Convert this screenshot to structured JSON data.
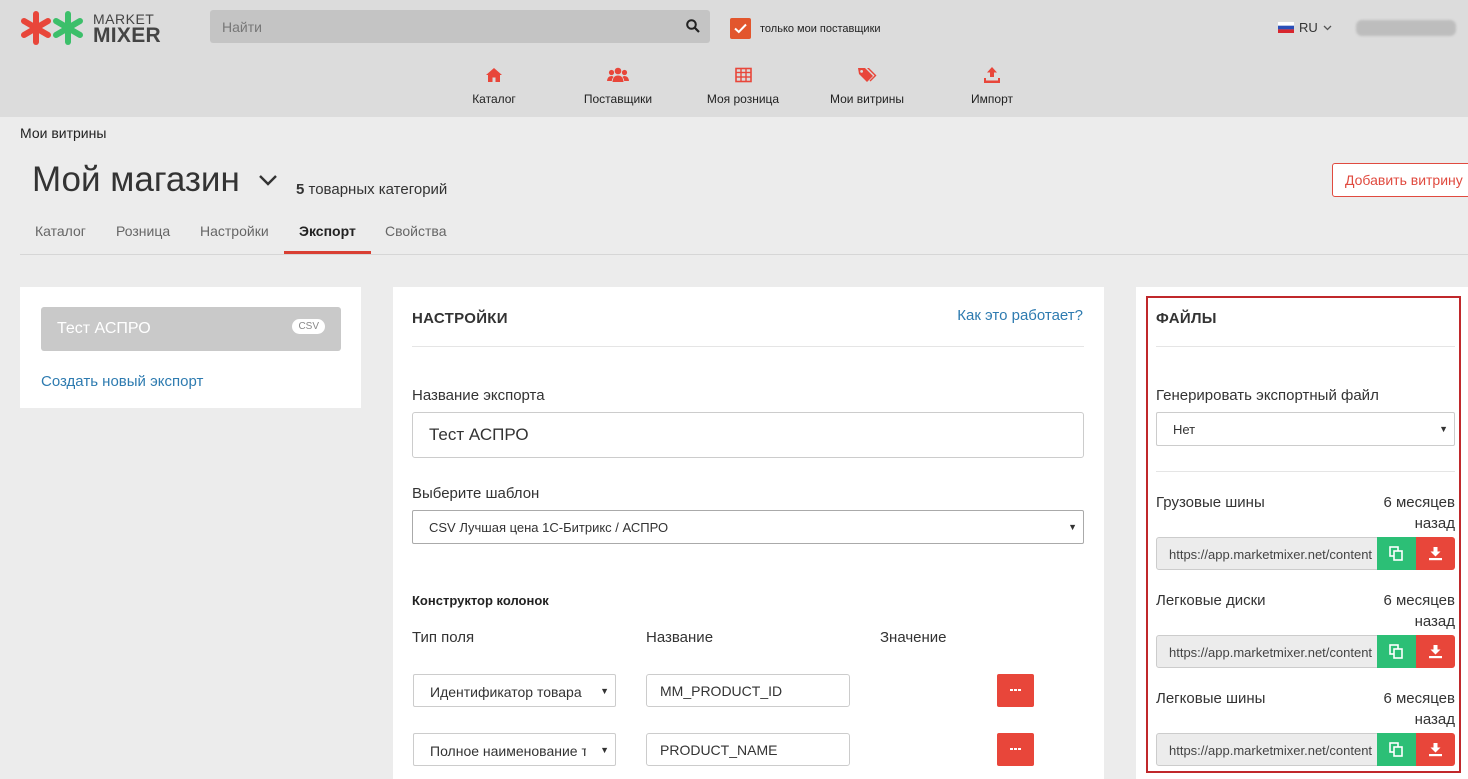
{
  "header": {
    "logo_line1": "MARKET",
    "logo_line2": "MIXER",
    "search_placeholder": "Найти",
    "only_my_suppliers": "только мои поставщики",
    "only_my_suppliers_checked": true,
    "language": "RU",
    "brand_color": "#e8463a",
    "accent_green": "#2cbf76"
  },
  "nav": [
    {
      "label": "Каталог",
      "icon": "home-icon"
    },
    {
      "label": "Поставщики",
      "icon": "users-icon"
    },
    {
      "label": "Моя розница",
      "icon": "table-icon"
    },
    {
      "label": "Мои витрины",
      "icon": "tags-icon"
    },
    {
      "label": "Импорт",
      "icon": "upload-icon"
    }
  ],
  "page": {
    "breadcrumb": "Мои витрины",
    "shop_title": "Мой магазин",
    "category_count": "5",
    "category_count_suffix": "товарных категорий",
    "add_button": "Добавить витрину",
    "tabs": [
      "Каталог",
      "Розница",
      "Настройки",
      "Экспорт",
      "Свойства"
    ],
    "active_tab": "Экспорт"
  },
  "exports": {
    "items": [
      {
        "name": "Тест АСПРО",
        "format": "CSV"
      }
    ],
    "create_link": "Создать новый экспорт"
  },
  "settings": {
    "title": "НАСТРОЙКИ",
    "help_link": "Как это работает?",
    "name_label": "Название экспорта",
    "name_value": "Тест АСПРО",
    "template_label": "Выберите шаблон",
    "template_value": "CSV Лучшая цена 1С-Битрикс / АСПРО",
    "constructor_title": "Конструктор колонок",
    "col_type": "Тип поля",
    "col_name": "Название",
    "col_value": "Значение",
    "rows": [
      {
        "type": "Идентификатор товара",
        "name": "MM_PRODUCT_ID"
      },
      {
        "type": "Полное наименование т",
        "name": "PRODUCT_NAME"
      }
    ]
  },
  "files": {
    "title": "ФАЙЛЫ",
    "generate_label": "Генерировать экспортный файл",
    "generate_value": "Нет",
    "items": [
      {
        "name": "Грузовые шины",
        "age": "6 месяцев назад",
        "url": "https://app.marketmixer.net/content"
      },
      {
        "name": "Легковые диски",
        "age": "6 месяцев назад",
        "url": "https://app.marketmixer.net/content"
      },
      {
        "name": "Легковые шины",
        "age": "6 месяцев назад",
        "url": "https://app.marketmixer.net/content"
      }
    ]
  }
}
